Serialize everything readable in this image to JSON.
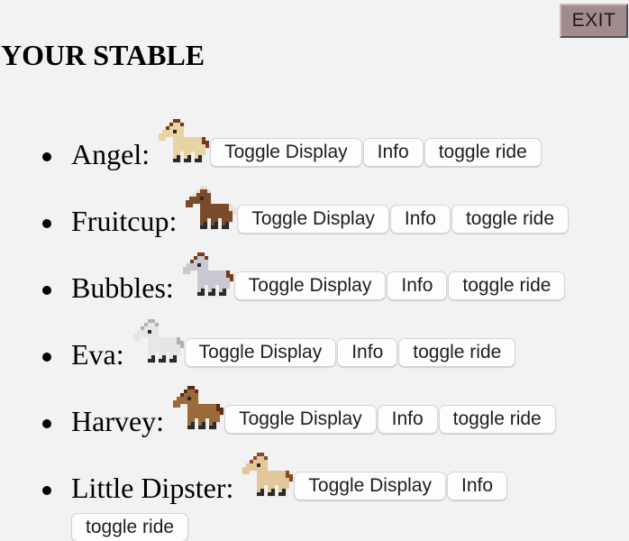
{
  "header": {
    "exit_label": "EXIT",
    "title": "YOUR STABLE"
  },
  "buttons": {
    "toggle_display": "Toggle Display",
    "info": "Info",
    "toggle_ride": "toggle ride"
  },
  "horses": [
    {
      "name": "Angel:",
      "coat": "#e8d3a4",
      "mane": "#7a3a1a",
      "icon": "horse-icon"
    },
    {
      "name": "Fruitcup:",
      "coat": "#7a4a2a",
      "mane": "#e8e0d0",
      "icon": "horse-icon"
    },
    {
      "name": "Bubbles:",
      "coat": "#c8c8d0",
      "mane": "#7a3a1a",
      "icon": "horse-icon"
    },
    {
      "name": "Eva:",
      "coat": "#e6e6e6",
      "mane": "#b0b0b0",
      "icon": "horse-icon"
    },
    {
      "name": "Harvey:",
      "coat": "#9a6a3a",
      "mane": "#5a2a1a",
      "icon": "horse-icon"
    },
    {
      "name": "Little Dipster:",
      "coat": "#e2c79a",
      "mane": "#8a4a2a",
      "icon": "horse-icon"
    }
  ],
  "colors": {
    "background": "#f2f2f3",
    "exit_button": "#a08c8c"
  }
}
